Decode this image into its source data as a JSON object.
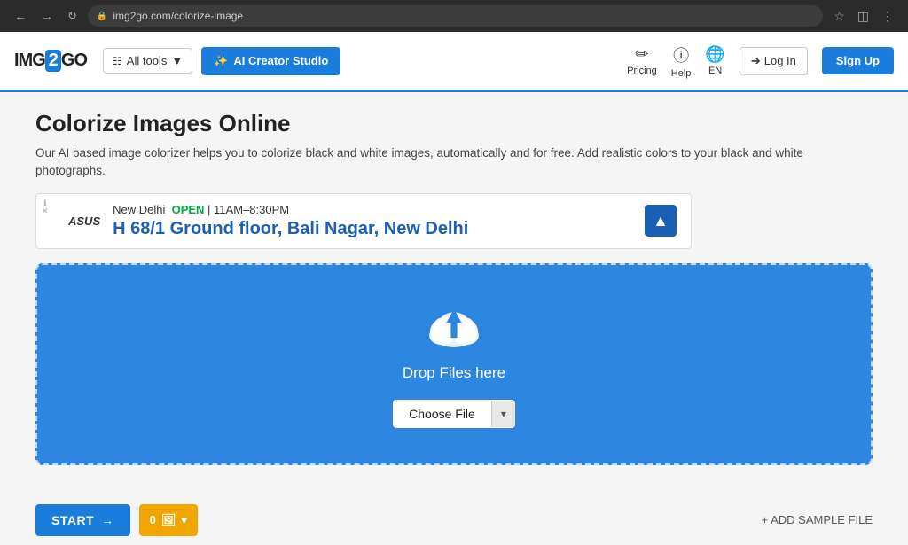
{
  "browser": {
    "url": "img2go.com/colorize-image",
    "back_title": "Back",
    "forward_title": "Forward",
    "refresh_title": "Refresh"
  },
  "navbar": {
    "logo_text_img": "IMG",
    "logo_text_2": "2",
    "logo_text_go": "GO",
    "all_tools_label": "All tools",
    "ai_creator_label": "AI Creator Studio",
    "pricing_label": "Pricing",
    "help_label": "Help",
    "lang_label": "EN",
    "login_label": "Log In",
    "signup_label": "Sign Up"
  },
  "page": {
    "title": "Colorize Images Online",
    "description": "Our AI based image colorizer helps you to colorize black and white images, automatically and for free. Add realistic colors to your black and white photographs."
  },
  "ad": {
    "info_label": "i",
    "close_label": "✕",
    "logo": "ASUS",
    "top_line": "New Delhi   OPEN  | 11AM–8:30PM",
    "address": "H 68/1 Ground floor, Bali Nagar, New Delhi"
  },
  "drop_zone": {
    "drop_text": "Drop Files here",
    "choose_file_label": "Choose File",
    "chevron": "▾"
  },
  "bottom_bar": {
    "start_label": "START",
    "start_arrow": "→",
    "files_count": "0",
    "files_icon": "🖼",
    "chevron": "▾",
    "add_sample_label": "+ ADD SAMPLE FILE"
  }
}
